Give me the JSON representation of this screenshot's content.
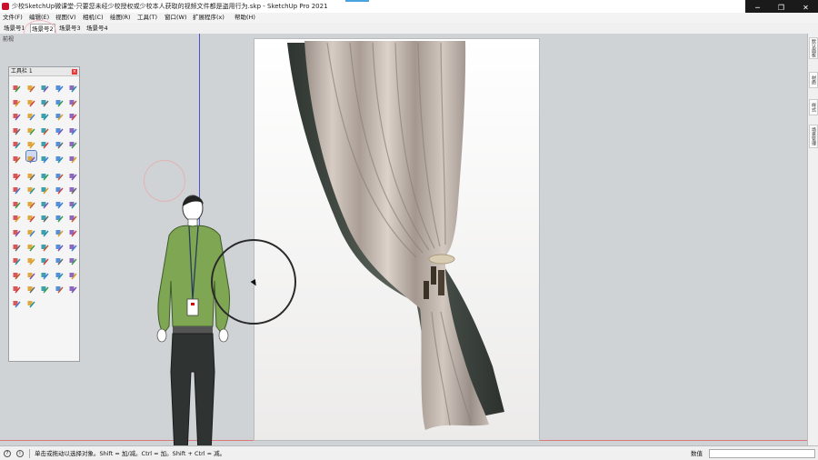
{
  "window": {
    "title": "少校SketchUp微课堂-只要您未经少校授权或少校本人获取的视频文件都是盗用行为.skp - SketchUp Pro 2021",
    "minimize_glyph": "─",
    "maximize_glyph": "❐",
    "close_glyph": "✕"
  },
  "menu": {
    "file": "文件(F)",
    "edit": "编辑(E)",
    "view": "视图(V)",
    "camera": "相机(C)",
    "draw": "绘图(R)",
    "tools": "工具(T)",
    "window": "窗口(W)",
    "extensions": "扩展程序(x)",
    "help": "帮助(H)"
  },
  "scenes": {
    "tab1": "场景号1",
    "tab2": "场景号2",
    "tab3": "场景号3",
    "tab4": "场景号4"
  },
  "viewport": {
    "label": "前视",
    "image_description_name": "curtain-render"
  },
  "toolbar_panel": {
    "title": "工具栏 1",
    "close_glyph": "×"
  },
  "tray": {
    "items": [
      "默认面板",
      "材质",
      "样式",
      "场景管理"
    ]
  },
  "status": {
    "message": "单击或拖动以选择对象。Shift = 加/减。Ctrl = 加。Shift + Ctrl = 减。",
    "measurements_label": "数值",
    "measurements_value": ""
  },
  "colors": {
    "viewport_bg": "#cfd3d6",
    "axis_blue": "#4a56c8",
    "axis_red": "#d97a7a",
    "curtain_front": "#b9aea6",
    "curtain_back": "#3f4741",
    "shirt": "#7fa653",
    "pants": "#2f3331"
  }
}
